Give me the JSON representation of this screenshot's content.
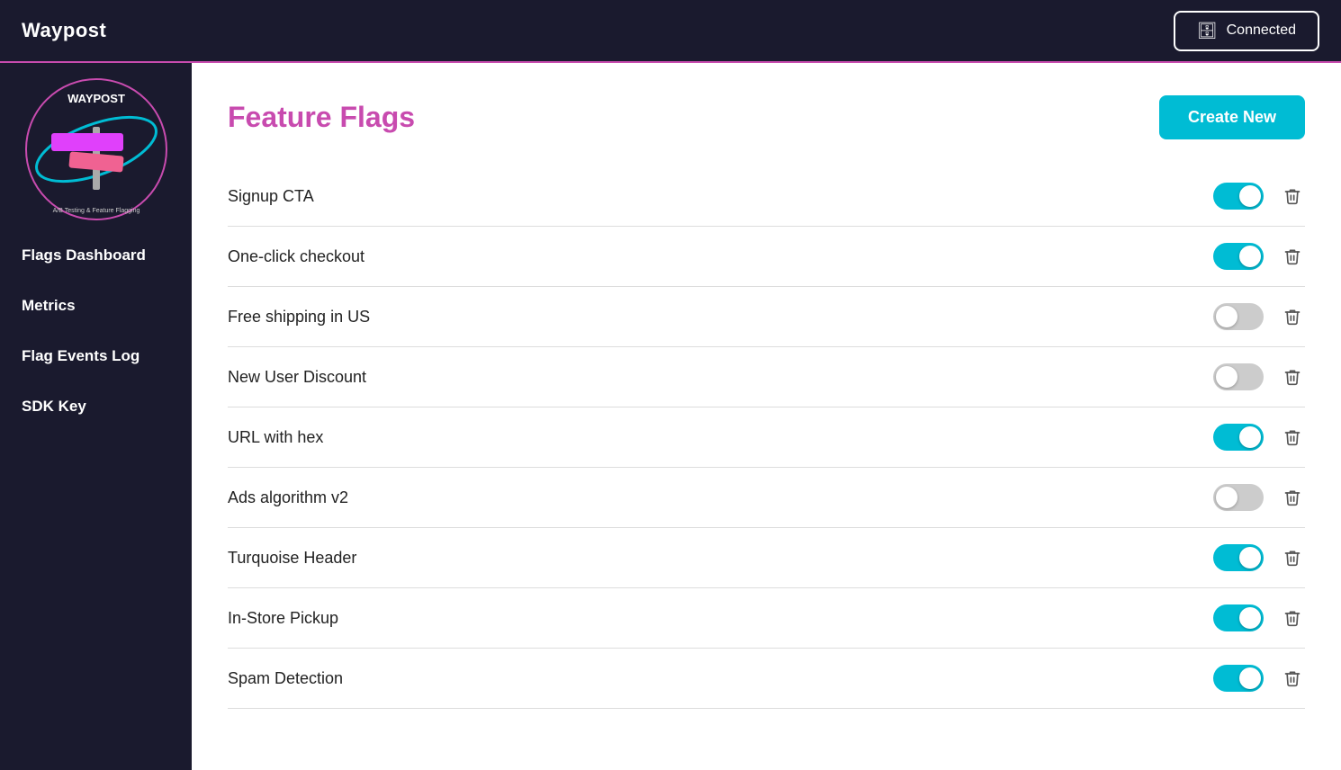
{
  "topbar": {
    "title": "Waypost",
    "connected_label": "Connected"
  },
  "sidebar": {
    "nav_items": [
      {
        "id": "flags-dashboard",
        "label": "Flags Dashboard"
      },
      {
        "id": "metrics",
        "label": "Metrics"
      },
      {
        "id": "flag-events-log",
        "label": "Flag Events Log"
      },
      {
        "id": "sdk-key",
        "label": "SDK Key"
      }
    ]
  },
  "main": {
    "title": "Feature Flags",
    "create_new_label": "Create New",
    "flags": [
      {
        "id": "signup-cta",
        "name": "Signup CTA",
        "enabled": true
      },
      {
        "id": "one-click-checkout",
        "name": "One-click checkout",
        "enabled": true
      },
      {
        "id": "free-shipping-us",
        "name": "Free shipping in US",
        "enabled": false
      },
      {
        "id": "new-user-discount",
        "name": "New User Discount",
        "enabled": false
      },
      {
        "id": "url-with-hex",
        "name": "URL with hex",
        "enabled": true
      },
      {
        "id": "ads-algorithm-v2",
        "name": "Ads algorithm v2",
        "enabled": false
      },
      {
        "id": "turquoise-header",
        "name": "Turquoise Header",
        "enabled": true
      },
      {
        "id": "in-store-pickup",
        "name": "In-Store Pickup",
        "enabled": true
      },
      {
        "id": "spam-detection",
        "name": "Spam Detection",
        "enabled": true
      }
    ]
  },
  "colors": {
    "accent_pink": "#c84baf",
    "accent_teal": "#00bcd4",
    "bg_dark": "#1a1a2e",
    "toggle_on": "#00bcd4",
    "toggle_off": "#cccccc"
  }
}
